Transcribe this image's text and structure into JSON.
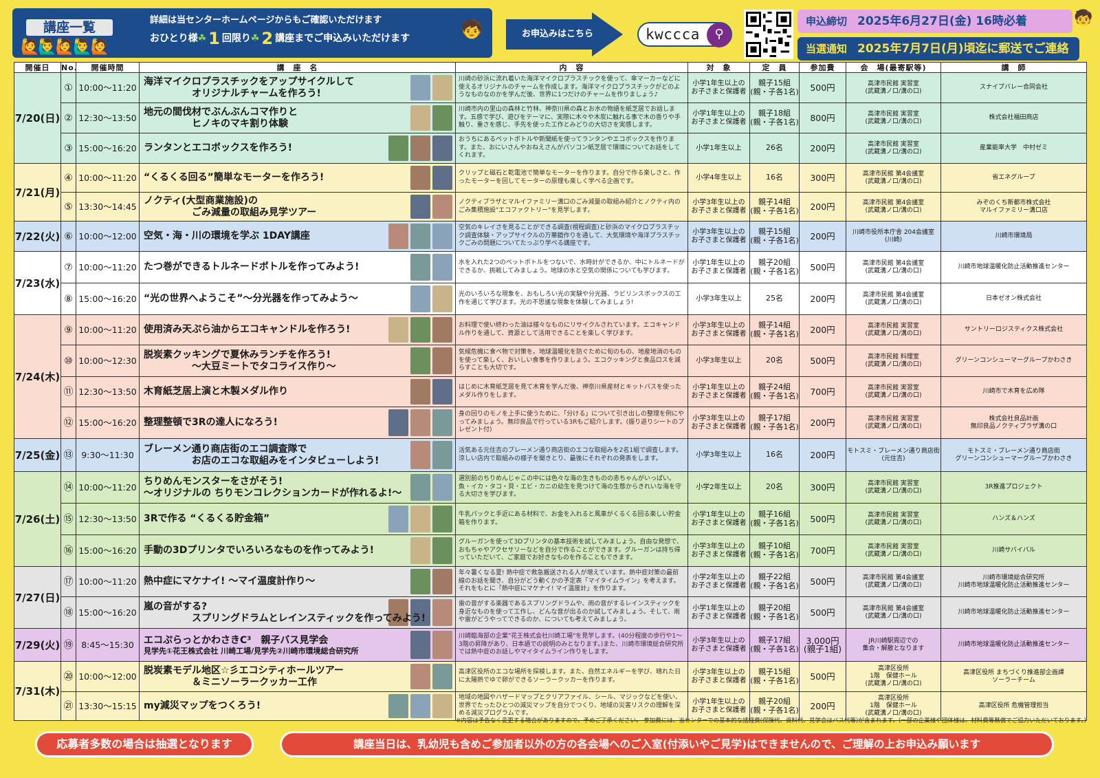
{
  "header": {
    "title": "講座一覧",
    "detail_line1": "詳細は当センターホームページからもご確認いただけます",
    "detail_a": "おひとり様",
    "detail_n1": "1",
    "detail_b": "回限り",
    "detail_n2": "2",
    "detail_c": "講座までご申込みいただけます",
    "apply_label": "お申込みはこちら",
    "search_query": "kwccca",
    "deadline_a": "申込締切",
    "deadline_b": "2025年6月27日(金) 16時必着",
    "notice_a": "当選通知",
    "notice_b": "2025年7月7日(月)頃迄に郵送でご連絡",
    "brand_color": "#1d4c8c"
  },
  "columns": [
    "開催日",
    "No.",
    "開催時間",
    "講　座　名",
    "内　容",
    "対　象",
    "定　員",
    "参加費",
    "会　場(最寄駅等)",
    "講　師"
  ],
  "groups": [
    {
      "date": "7/20(日)",
      "color": "#cfeee0",
      "rows": [
        {
          "no": "①",
          "time": "10:00～11:20",
          "title": "海洋マイクロプラスチックをアップサイクルして\n　　　　　オリジナルチャームを作ろう!",
          "content": "川崎の砂浜に流れ着いた海洋マイクロプラスチックを使って、傘マーカーなどに使えるオリジナルのチャームを作成します。海洋マイクロプラスチックがどのようなものなのかを学んだ後、世界に1つだけのチャームを作りましょう♪",
          "target": "小学1年生以上の\nお子さまと保護者",
          "capacity": "親子15組\n(親・子各1名)",
          "fee": "500円",
          "venue": "高津市民館 実習室\n(武蔵溝ノ口/溝の口)",
          "instructor": "スナイプバレー合同会社"
        },
        {
          "no": "②",
          "time": "12:30～13:50",
          "title": "地元の間伐材でぶんぶんコマ作りと\n　　　　　ヒノキのマキ割り体験",
          "content": "川崎市内の里山の森林と竹林、神奈川県の森とお水の物語を紙芝居でお話します。五感で学び、遊びをテーマに、実際に木々や木炭に触れる事で木の香りや手触り、重さを感じ、手先を使った工作とみどりの大切さを実感します。",
          "target": "小学1年生以上の\nお子さまと保護者",
          "capacity": "親子18組\n(親・子各1名)",
          "fee": "800円",
          "venue": "高津市民館 実習室\n(武蔵溝ノ口/溝の口)",
          "instructor": "株式会社福田商店"
        },
        {
          "no": "③",
          "time": "15:00～16:20",
          "title": "ランタンとエコボックスを作ろう!",
          "content": "おうちにあるペットボトルや新聞紙を使ってランタンやエコボックスを作ります。また、おにいさんやおねえさんがパソコン紙芝居で環境についてお話をしてくれます。",
          "target": "小学1年生以上",
          "capacity": "26名",
          "fee": "200円",
          "venue": "高津市民館 実習室\n(武蔵溝ノ口/溝の口)",
          "instructor": "産業能率大学　中村ゼミ"
        }
      ]
    },
    {
      "date": "7/21(月)",
      "color": "#fbf2c4",
      "rows": [
        {
          "no": "④",
          "time": "10:00～11:20",
          "title": "“くるくる回る”簡単なモーターを作ろう!",
          "content": "クリップと磁石と乾電池で簡単なモーターを作ります。自分で作る楽しさと、作ったモーターを回してモーターの原理も楽しく学べる企画です。",
          "target": "小学4年生以上",
          "capacity": "16名",
          "fee": "300円",
          "venue": "高津市民館 第4会議室\n(武蔵溝ノ口/溝の口)",
          "instructor": "省エネグループ"
        },
        {
          "no": "⑤",
          "time": "13:30～14:45",
          "title": "ノクティ(大型商業施設)の\n　　　　　ごみ減量の取組み見学ツアー",
          "content": "ノクティプラザとマルイファミリー溝口のごみ減量の取組み紹介とノクティ内のごみ集積施設\"エコファクトリー\"を見学します。",
          "target": "小学3年生以上の\nお子さまと保護者",
          "capacity": "親子14組\n(親・子各1名)",
          "fee": "200円",
          "venue": "高津市民館 第4会議室\n(武蔵溝ノ口/溝の口)",
          "instructor": "みぞのくち新都市株式会社\nマルイファミリー溝口店"
        }
      ]
    },
    {
      "date": "7/22(火)",
      "color": "#cfe0f2",
      "rows": [
        {
          "no": "⑥",
          "time": "10:00～12:00",
          "title": "空気・海・川の環境を学ぶ 1DAY講座",
          "content": "空気のキレイさを見ることができる調査(視程調査)と砂浜のマイクロプラスチック調査体験・アップサイクルの万華鏡作りを通して、大気環境や海洋プラスチックごみの問題についてたっぷり学べる講座です。",
          "target": "小学3年生以上の\nお子さまと保護者",
          "capacity": "親子15組\n(親・子各1名)",
          "fee": "200円",
          "venue": "川崎市役所本庁舎 204会議室\n(川崎)",
          "instructor": "川崎市環境局"
        }
      ]
    },
    {
      "date": "7/23(水)",
      "color": "#ffffff",
      "rows": [
        {
          "no": "⑦",
          "time": "10:00～11:20",
          "title": "たつ巻ができるトルネードボトルを作ってみよう!",
          "content": "水を入れた2つのペットボトルをつないで、水時計ができるか、中にトルネードができるか、挑戦してみましょう。地球の水と空気の関係についても学びます。",
          "target": "小学1年生以上の\nお子さまと保護者",
          "capacity": "親子20組\n(親・子各1名)",
          "fee": "500円",
          "venue": "高津市民館 第4会議室\n(武蔵溝ノ口/溝の口)",
          "instructor": "川崎市地球温暖化防止活動推進センター"
        },
        {
          "no": "⑧",
          "time": "15:00～16:20",
          "title": "“光の世界へようこそ”～分光器を作ってみよう～",
          "content": "光のいろいろな現象を、おもしろい光の実験や分光器、ラビリンスボックスの工作を通じて学びます。光の不思議な現象を体験してみましょう!",
          "target": "小学3年生以上",
          "capacity": "25名",
          "fee": "200円",
          "venue": "高津市民館 第4会議室\n(武蔵溝ノ口/溝の口)",
          "instructor": "日本ゼオン株式会社"
        }
      ]
    },
    {
      "date": "7/24(木)",
      "color": "#fbdcd0",
      "rows": [
        {
          "no": "⑨",
          "time": "10:00～11:20",
          "title": "使用済み天ぷら油からエコキャンドルを作ろう!",
          "content": "お料理で使い終わった油は様々なものにリサイクルされています。エコキャンドル作りを通して、資源として活用できることを楽しく学びます。",
          "target": "小学3年生以上の\nお子さまと保護者",
          "capacity": "親子14組\n(親・子各1名)",
          "fee": "200円",
          "venue": "高津市民館 実習室\n(武蔵溝ノ口/溝の口)",
          "instructor": "サントリーロジスティクス株式会社"
        },
        {
          "no": "⑩",
          "time": "10:00～12:30",
          "title": "脱炭素クッキングで夏休みランチを作ろう!\n　　　　　～大豆ミートでタコライス作り～",
          "content": "気候危機に食べ物で対策を。地球温暖化を防ぐために旬のもの、地産地消のものを使って楽しく、おいしい食事を作りましょう。エコクッキングと食品ロスを減らすことも大切です。",
          "target": "小学3年生以上",
          "capacity": "20名",
          "fee": "500円",
          "venue": "高津市民館 料理室\n(武蔵溝ノ口/溝の口)",
          "instructor": "グリーンコンシューマーグループかわさき"
        },
        {
          "no": "⑪",
          "time": "12:30～13:50",
          "title": "木育紙芝居上演と木製メダル作り",
          "content": "はじめに木育紙芝居を見て木育を学んだ後、神奈川県産材とキットパスを使ったメダル作りをします。",
          "target": "小学1年生以上の\nお子さまと保護者",
          "capacity": "親子24組\n(親・子各1名)",
          "fee": "700円",
          "venue": "高津市民館 実習室\n(武蔵溝ノ口/溝の口)",
          "instructor": "川崎市で木育を広め隊"
        },
        {
          "no": "⑫",
          "time": "15:00～16:20",
          "title": "整理整頓で3Rの達人になろう!",
          "content": "身の回りのモノを上手に使うために、「分ける」について引き出しの整理を例にやってみましょう。無印良品で行っている3Rもご紹介します。(振り返りシートのプレゼント付)",
          "target": "小学3年生以上の\nお子さまと保護者",
          "capacity": "親子17組\n(親・子各1名)",
          "fee": "200円",
          "venue": "高津市民館 実習室\n(武蔵溝ノ口/溝の口)",
          "instructor": "株式会社良品計画\n無印良品ノクティプラザ溝の口"
        }
      ]
    },
    {
      "date": "7/25(金)",
      "color": "#cfe0f2",
      "rows": [
        {
          "no": "⑬",
          "time": "9:30～11:30",
          "title": "ブレーメン通り商店街のエコ調査隊で\n　　　　　お店のエコな取組みをインタビューしよう!",
          "content": "活気ある元住吉のブレーメン通り商店街のエコな取組みを2名1組で調査します。涼しい店内で取組みの様子を聞きとり、最後にそれぞれの発表をします。",
          "target": "小学3年生以上",
          "capacity": "16名",
          "fee": "200円",
          "venue": "モトスミ・ブレーメン通り商店街\n(元住吉)",
          "instructor": "モトスミ・ブレーメン通り商店街\nグリーンコンシューマーグループかわさき"
        }
      ]
    },
    {
      "date": "7/26(土)",
      "color": "#d6ebc2",
      "rows": [
        {
          "no": "⑭",
          "time": "10:00～11:20",
          "title": "ちりめんモンスターをさがそう!\n～オリジナルの ちりモンコレクションカードが作れるよ!～",
          "content": "選別前のちりめんじゃこの中には色々な海の生きものの赤ちゃんがいっぱい。魚・イカ・タコ・貝・エビ・カニの幼生を見つけて海の生態からきれいな海を守る大切さを学びます。",
          "target": "小学2年生以上",
          "capacity": "20名",
          "fee": "300円",
          "venue": "高津市民館 実習室\n(武蔵溝ノ口/溝の口)",
          "instructor": "3R推進プロジェクト"
        },
        {
          "no": "⑮",
          "time": "12:30～13:50",
          "title": "3Rで作る “くるくる貯金箱”",
          "content": "牛乳パックと手近にある材料で、お金を入れると風車がくるくる回る楽しい貯金箱を作ります。",
          "target": "小学1年生以上の\nお子さまと保護者",
          "capacity": "親子16組\n(親・子各1名)",
          "fee": "500円",
          "venue": "高津市民館 実習室\n(武蔵溝ノ口/溝の口)",
          "instructor": "ハンズ＆ハンズ"
        },
        {
          "no": "⑯",
          "time": "15:00～16:20",
          "title": "手動の3Dプリンタでいろいろなものを作ってみよう!",
          "content": "グルーガンを使って3Dプリンタの基本技術を試してみましょう。自由な発想で、おもちゃやアクセサリーなどを自分で作ることができます。グルーガンは持ち帰っていただいて、ご家庭でお好きなものを作ることもできます。",
          "target": "小学3年生以上の\nお子さまと保護者",
          "capacity": "親子10組\n(親・子各1名)",
          "fee": "700円",
          "venue": "高津市民館 実習室\n(武蔵溝ノ口/溝の口)",
          "instructor": "川崎サバイバル"
        }
      ]
    },
    {
      "date": "7/27(日)",
      "color": "#e4e4e4",
      "rows": [
        {
          "no": "⑰",
          "time": "10:00～11:20",
          "title": "熱中症にマケナイ! ～マイ温度計作り～",
          "content": "年々暑くなる夏! 熱中症で救急搬送される人が増えています。熱中症対策の最前線のお話を聞き、自分がどう動くかの予定表「マイタイムライン」を考えます。それをもとに「熱中症にマケナイ! マイ温度計」を作ります。",
          "target": "小学2年生以上の\nお子さまと保護者",
          "capacity": "親子22組\n(親・子各1名)",
          "fee": "500円",
          "venue": "高津市民館 第4会議室\n(武蔵溝ノ口/溝の口)",
          "instructor": "川崎市環境総合研究所\n川崎市地球温暖化防止活動推進センター"
        },
        {
          "no": "⑱",
          "time": "15:00～16:20",
          "title": "嵐の音がする?\n　　　　　スプリングドラムとレインスティックを作ってみよう!",
          "content": "雷の音がする楽器であるスプリングドラムや、雨の音がするレインスティックを身近なものを使って工作し、どんな音が出るのか試してみましょう。そして、雨や雷がどうやってできるのか、についても考えてみましょう。",
          "target": "小学1年生以上の\nお子さまと保護者",
          "capacity": "親子20組\n(親・子各1名)",
          "fee": "500円",
          "venue": "高津市民館 第4会議室\n(武蔵溝ノ口/溝の口)",
          "instructor": "川崎市地球温暖化防止活動推進センター"
        }
      ]
    },
    {
      "date": "7/29(火)",
      "color": "#e3c6ea",
      "rows": [
        {
          "no": "⑲",
          "time": "8:45～15:30",
          "title": "エコぷらっとかわさきC³　親子バス見学会",
          "subtitle": "見学先①花王株式会社 川崎工場/見学先②川崎市環境総合研究所",
          "content": "川崎臨海部の企業\"花王株式会社川崎工場\"を見学します。(40分程度の歩行や1～3階の昇降があり、日本語での説明のみとなります。)また、川崎市環境総合研究所では熱中症のお話しやマイタイムライン作りをします。",
          "target": "小学3年生以上の\nお子さまと保護者",
          "capacity": "親子17組\n(親・子各1名)",
          "fee": "3,000円\n(親子1組)",
          "venue": "JR川崎駅周辺での\n集合・解散となります",
          "instructor": "川崎市地球温暖化防止活動推進センター"
        }
      ]
    },
    {
      "date": "7/31(木)",
      "color": "#fbf2c4",
      "rows": [
        {
          "no": "⑳",
          "time": "10:00～12:00",
          "title": "脱炭素モデル地区☆彡エコシティホールツアー\n　　　　　＆ミニソーラークッカー工作",
          "content": "高津区役所のエコな場所を探検します。また、自然エネルギーを学び、晴れた日に太陽熱でゆで卵ができるソーラークッカーを作ります。",
          "target": "小学3年生以上の\nお子さまと保護者",
          "capacity": "親子15組\n(親・子各1名)",
          "fee": "500円",
          "venue": "高津区役所\n1階　保健ホール\n(武蔵溝ノ口/溝の口)",
          "instructor": "高津区役所 まちづくり推進部企画課\nソーラーチーム"
        },
        {
          "no": "㉑",
          "time": "13:30～15:15",
          "title": "my減災マップをつくろう!",
          "content": "地域の地図やハザードマップとクリアファイル、シール、マジックなどを使い、世界でたったひとつの減災マップを自分でつくり、地域の災害リスクの理解を深める減災プログラムです。",
          "target": "小学1年生以上の\nお子さまと保護者",
          "capacity": "親子20組\n(親・子各1名)",
          "fee": "200円",
          "venue": "高津区役所\n1階　保健ホール\n(武蔵溝ノ口/溝の口)",
          "instructor": "高津区役所 危機管理担当"
        }
      ]
    }
  ],
  "footnote": "※内容は予告なく変更する場合がありますので、予めご了承ください。 参加費には、当センターでの基本的な諸経費(保険代、資料代、見学会はバス代等)が含まれます。(一部の企業様や団体様は、材料費等無償でご協力いただいております。)",
  "banner_left": "応募者多数の場合は抽選となります",
  "banner_right": "講座当日は、乳幼児も含めご参加者以外の方の各会場へのご入室(付添いやご見学)はできませんので、ご理解の上お申込み願います"
}
